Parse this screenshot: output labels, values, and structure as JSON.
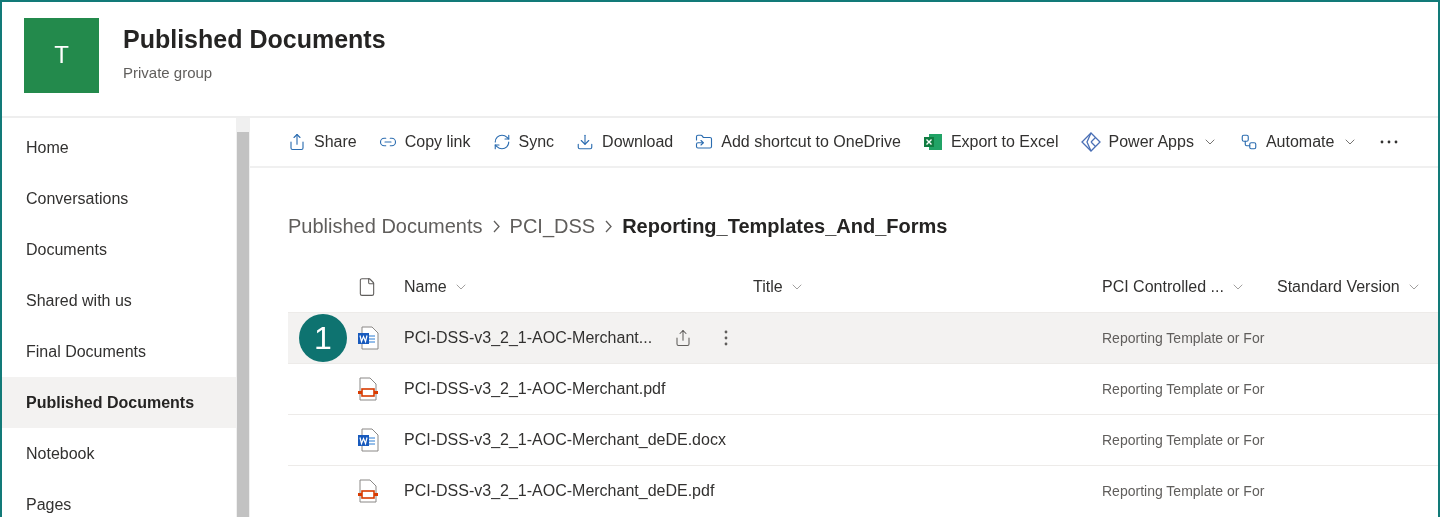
{
  "site": {
    "logo_letter": "T",
    "title": "Published Documents",
    "subtitle": "Private group"
  },
  "sidebar": {
    "items": [
      {
        "label": "Home",
        "selected": false
      },
      {
        "label": "Conversations",
        "selected": false
      },
      {
        "label": "Documents",
        "selected": false
      },
      {
        "label": "Shared with us",
        "selected": false
      },
      {
        "label": "Final Documents",
        "selected": false
      },
      {
        "label": "Published Documents",
        "selected": true
      },
      {
        "label": "Notebook",
        "selected": false
      },
      {
        "label": "Pages",
        "selected": false
      }
    ]
  },
  "command_bar": [
    {
      "kind": "share",
      "label": "Share",
      "menu": false
    },
    {
      "kind": "link",
      "label": "Copy link",
      "menu": false
    },
    {
      "kind": "sync",
      "label": "Sync",
      "menu": false
    },
    {
      "kind": "download",
      "label": "Download",
      "menu": false
    },
    {
      "kind": "shortcut",
      "label": "Add shortcut to OneDrive",
      "menu": false
    },
    {
      "kind": "excel",
      "label": "Export to Excel",
      "menu": false
    },
    {
      "kind": "powerapps",
      "label": "Power Apps",
      "menu": true
    },
    {
      "kind": "automate",
      "label": "Automate",
      "menu": true
    },
    {
      "kind": "more",
      "menu": false
    }
  ],
  "breadcrumb": [
    {
      "label": "Published Documents",
      "current": false
    },
    {
      "label": "PCI_DSS",
      "current": false
    },
    {
      "label": "Reporting_Templates_And_Forms",
      "current": true
    }
  ],
  "table": {
    "columns": [
      "Name",
      "Title",
      "PCI Controlled ...",
      "Standard Version"
    ],
    "rows": [
      {
        "kind": "docx",
        "name": "PCI-DSS-v3_2_1-AOC-Merchant...",
        "pci": "Reporting Template or For",
        "selected": true,
        "callout": "1"
      },
      {
        "kind": "pdf",
        "name": "PCI-DSS-v3_2_1-AOC-Merchant.pdf",
        "pci": "Reporting Template or For",
        "selected": false
      },
      {
        "kind": "docx",
        "name": "PCI-DSS-v3_2_1-AOC-Merchant_deDE.docx",
        "pci": "Reporting Template or For",
        "selected": false
      },
      {
        "kind": "pdf",
        "name": "PCI-DSS-v3_2_1-AOC-Merchant_deDE.pdf",
        "pci": "Reporting Template or For",
        "selected": false
      }
    ]
  }
}
